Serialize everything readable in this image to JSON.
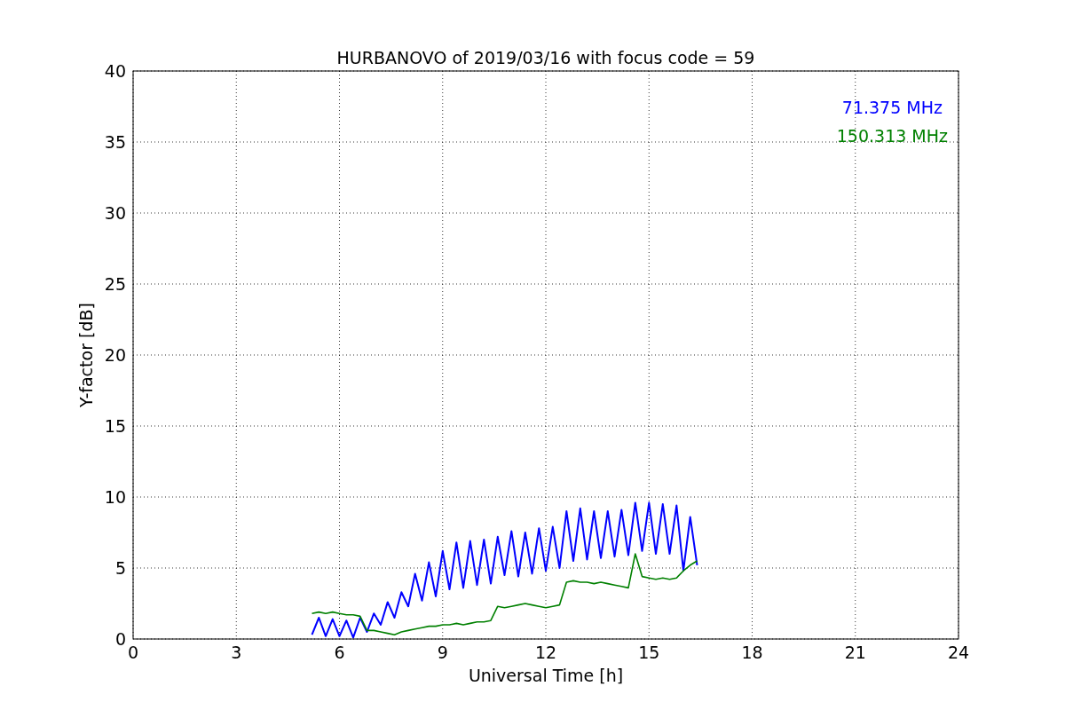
{
  "chart_data": {
    "type": "line",
    "title": "HURBANOVO of 2019/03/16 with focus code = 59",
    "xlabel": "Universal Time [h]",
    "ylabel": "Y-factor [dB]",
    "x": [
      5.2,
      5.4,
      5.6,
      5.8,
      6.0,
      6.2,
      6.4,
      6.6,
      6.8,
      7.0,
      7.2,
      7.4,
      7.6,
      7.8,
      8.0,
      8.2,
      8.4,
      8.6,
      8.8,
      9.0,
      9.2,
      9.4,
      9.6,
      9.8,
      10.0,
      10.2,
      10.4,
      10.6,
      10.8,
      11.0,
      11.2,
      11.4,
      11.6,
      11.8,
      12.0,
      12.2,
      12.4,
      12.6,
      12.8,
      13.0,
      13.2,
      13.4,
      13.6,
      13.8,
      14.0,
      14.2,
      14.4,
      14.6,
      14.8,
      15.0,
      15.2,
      15.4,
      15.6,
      15.8,
      16.0,
      16.2,
      16.4
    ],
    "series": [
      {
        "name": "71.375 MHz",
        "color": "#0000ff",
        "values": [
          0.3,
          1.5,
          0.2,
          1.4,
          0.2,
          1.3,
          0.1,
          1.5,
          0.5,
          1.8,
          1.0,
          2.6,
          1.5,
          3.3,
          2.3,
          4.6,
          2.7,
          5.4,
          3.0,
          6.2,
          3.5,
          6.8,
          3.6,
          6.9,
          3.8,
          7.0,
          3.9,
          7.2,
          4.5,
          7.6,
          4.4,
          7.5,
          4.6,
          7.8,
          4.8,
          7.9,
          5.0,
          9.0,
          5.5,
          9.2,
          5.6,
          9.0,
          5.7,
          9.0,
          5.8,
          9.1,
          5.9,
          9.6,
          6.2,
          9.6,
          6.0,
          9.5,
          6.0,
          9.4,
          4.8,
          8.6,
          5.2
        ]
      },
      {
        "name": "150.313 MHz",
        "color": "#008000",
        "values": [
          1.8,
          1.9,
          1.8,
          1.9,
          1.8,
          1.7,
          1.7,
          1.6,
          0.6,
          0.6,
          0.5,
          0.4,
          0.3,
          0.5,
          0.6,
          0.7,
          0.8,
          0.9,
          0.9,
          1.0,
          1.0,
          1.1,
          1.0,
          1.1,
          1.2,
          1.2,
          1.3,
          2.3,
          2.2,
          2.3,
          2.4,
          2.5,
          2.4,
          2.3,
          2.2,
          2.3,
          2.4,
          4.0,
          4.1,
          4.0,
          4.0,
          3.9,
          4.0,
          3.9,
          3.8,
          3.7,
          3.6,
          6.0,
          4.4,
          4.3,
          4.2,
          4.3,
          4.2,
          4.3,
          4.8,
          5.2,
          5.5
        ]
      }
    ],
    "xlim": [
      0,
      24
    ],
    "ylim": [
      0,
      40
    ],
    "xticks": [
      0,
      3,
      6,
      9,
      12,
      15,
      18,
      21,
      24
    ],
    "yticks": [
      0,
      5,
      10,
      15,
      20,
      25,
      30,
      35,
      40
    ],
    "grid": true
  }
}
